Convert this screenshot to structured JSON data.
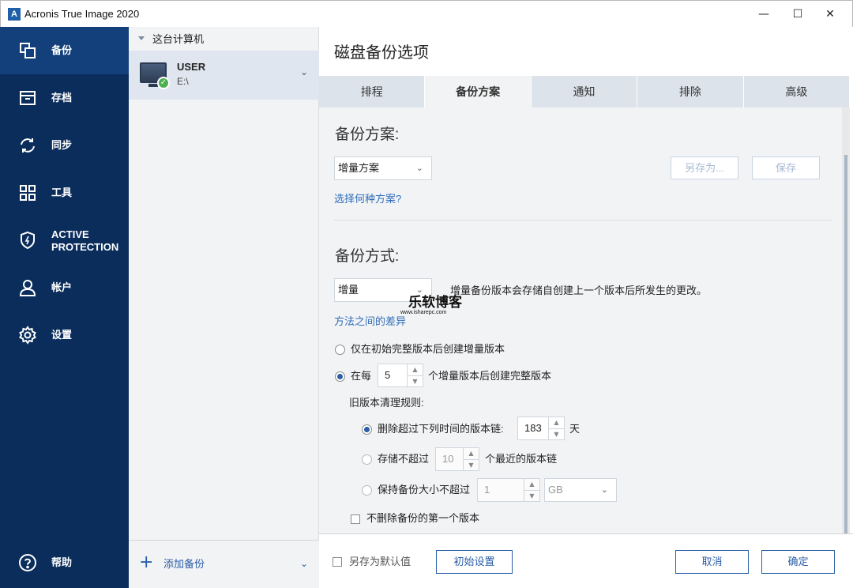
{
  "window": {
    "title": "Acronis True Image 2020",
    "app_icon_letter": "A",
    "min": "—",
    "max": "☐",
    "close": "✕"
  },
  "nav": {
    "items": [
      {
        "label": "备份",
        "icon": "backup-icon"
      },
      {
        "label": "存档",
        "icon": "archive-icon"
      },
      {
        "label": "同步",
        "icon": "sync-icon"
      },
      {
        "label": "工具",
        "icon": "tools-icon"
      },
      {
        "label": "ACTIVE PROTECTION",
        "label_line1": "ACTIVE",
        "label_line2": "PROTECTION",
        "icon": "shield-icon"
      },
      {
        "label": "帐户",
        "icon": "account-icon"
      },
      {
        "label": "设置",
        "icon": "settings-icon"
      }
    ],
    "help": "帮助",
    "accent": "#0b2d5c",
    "active_bg": "#13407a"
  },
  "sources": {
    "header": "这台计算机",
    "device_name": "USER",
    "device_path": "E:\\",
    "add_backup": "添加备份"
  },
  "main": {
    "title": "磁盘备份选项",
    "tabs": [
      "排程",
      "备份方案",
      "通知",
      "排除",
      "高级"
    ],
    "active_tab": "备份方案",
    "scheme": {
      "section_title": "备份方案:",
      "selected": "增量方案",
      "save_as": "另存为...",
      "save": "保存",
      "help_link": "选择何种方案?"
    },
    "method": {
      "section_title": "备份方式:",
      "selected": "增量",
      "description": "增量备份版本会存储自创建上一个版本后所发生的更改。",
      "diff_link": "方法之间的差异",
      "option1": "仅在初始完整版本后创建增量版本",
      "option2_prefix": "在每",
      "option2_value": "5",
      "option2_suffix": "个增量版本后创建完整版本"
    },
    "cleanup": {
      "heading": "旧版本清理规则:",
      "rule1_label": "删除超过下列时间的版本链:",
      "rule1_value": "183",
      "rule1_unit": "天",
      "rule2_label": "存储不超过",
      "rule2_value": "10",
      "rule2_suffix": "个最近的版本链",
      "rule3_label": "保持备份大小不超过",
      "rule3_value": "1",
      "rule3_unit": "GB",
      "keep_first": "不删除备份的第一个版本"
    },
    "watermark": {
      "text": "乐软博客",
      "url": "www.isharepc.com"
    }
  },
  "footer": {
    "save_default": "另存为默认值",
    "reset": "初始设置",
    "cancel": "取消",
    "ok": "确定"
  }
}
